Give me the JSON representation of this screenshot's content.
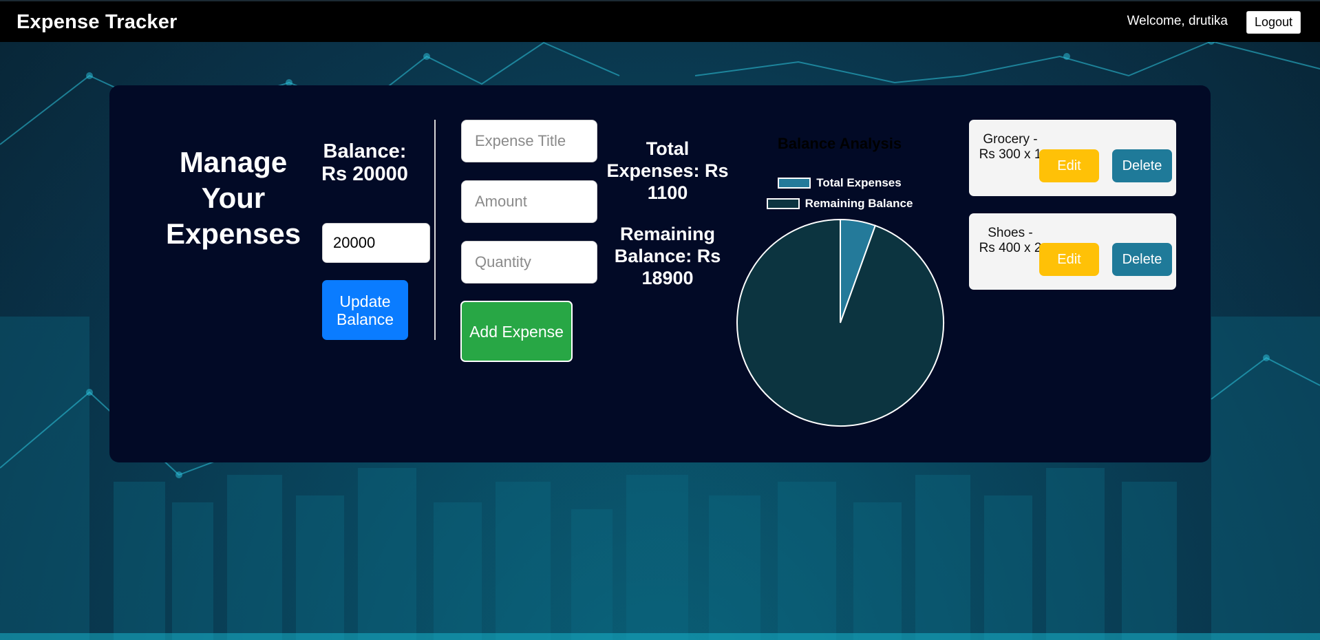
{
  "navbar": {
    "brand": "Expense Tracker",
    "welcome": "Welcome, drutika",
    "logout_label": "Logout"
  },
  "main": {
    "heading": "Manage Your Expenses",
    "balance_label": "Balance: Rs 20000",
    "balance_input_value": "20000",
    "update_balance_label": "Update Balance",
    "form": {
      "title_placeholder": "Expense Title",
      "amount_placeholder": "Amount",
      "quantity_placeholder": "Quantity",
      "add_label": "Add Expense"
    },
    "total_expenses": "Total Expenses: Rs 1100",
    "remaining_balance": "Remaining Balance: Rs 18900"
  },
  "chart_data": {
    "type": "pie",
    "title": "Balance Analysis",
    "labels": [
      "Total Expenses",
      "Remaining Balance"
    ],
    "values": [
      1100,
      18900
    ],
    "colors": [
      "#247a9a",
      "#0c3440"
    ],
    "legend": "top"
  },
  "expenses": [
    {
      "text": "Grocery - Rs 300 x 1",
      "edit_label": "Edit",
      "delete_label": "Delete"
    },
    {
      "text": "Shoes - Rs 400 x 2",
      "edit_label": "Edit",
      "delete_label": "Delete"
    }
  ],
  "colors": {
    "navbar": "#000000",
    "panel": "#020a26",
    "update_button": "#0a7cff",
    "add_button": "#28a745",
    "edit_button": "#ffc107",
    "delete_button": "#1f7a99"
  }
}
